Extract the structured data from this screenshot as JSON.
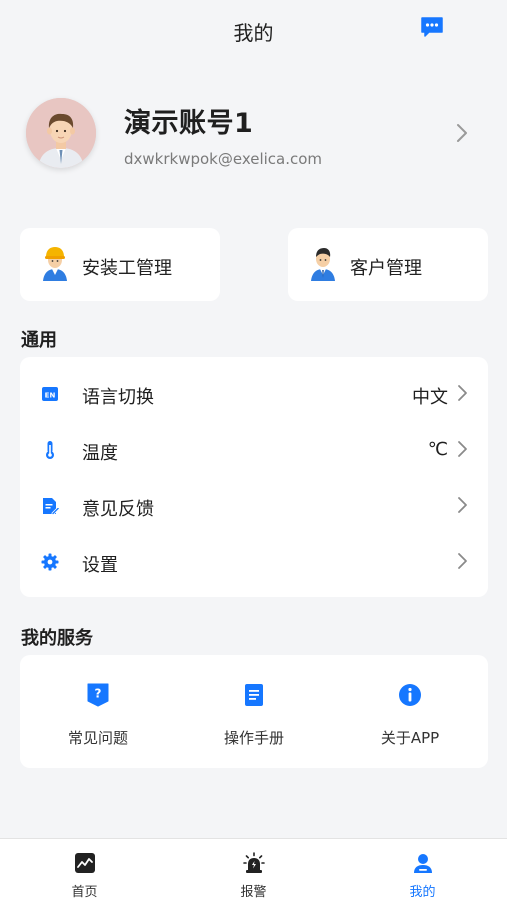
{
  "header": {
    "title": "我的",
    "message_icon": "chat-bubble-icon"
  },
  "profile": {
    "name": "演示账号1",
    "email": "dxwkrkwpok@exelica.com",
    "avatar_icon": "avatar-man-icon"
  },
  "quick_cards": [
    {
      "label": "安装工管理",
      "icon": "installer-worker-icon"
    },
    {
      "label": "客户管理",
      "icon": "customer-person-icon"
    }
  ],
  "general": {
    "title": "通用",
    "items": [
      {
        "label": "语言切换",
        "value": "中文",
        "icon": "language-en-icon"
      },
      {
        "label": "温度",
        "value": "℃",
        "icon": "thermometer-icon"
      },
      {
        "label": "意见反馈",
        "value": "",
        "icon": "feedback-edit-icon"
      },
      {
        "label": "设置",
        "value": "",
        "icon": "gear-icon"
      }
    ]
  },
  "services": {
    "title": "我的服务",
    "items": [
      {
        "label": "常见问题",
        "icon": "help-question-icon"
      },
      {
        "label": "操作手册",
        "icon": "manual-book-icon"
      },
      {
        "label": "关于APP",
        "icon": "info-icon"
      }
    ]
  },
  "tabbar": {
    "items": [
      {
        "label": "首页",
        "icon": "chart-home-icon",
        "active": false
      },
      {
        "label": "报警",
        "icon": "alarm-siren-icon",
        "active": false
      },
      {
        "label": "我的",
        "icon": "user-profile-icon",
        "active": true
      }
    ]
  },
  "colors": {
    "accent": "#1677ff",
    "background": "#f4f5f7",
    "card": "#ffffff",
    "text": "#1f1f1f",
    "muted": "#7a7a7a"
  }
}
